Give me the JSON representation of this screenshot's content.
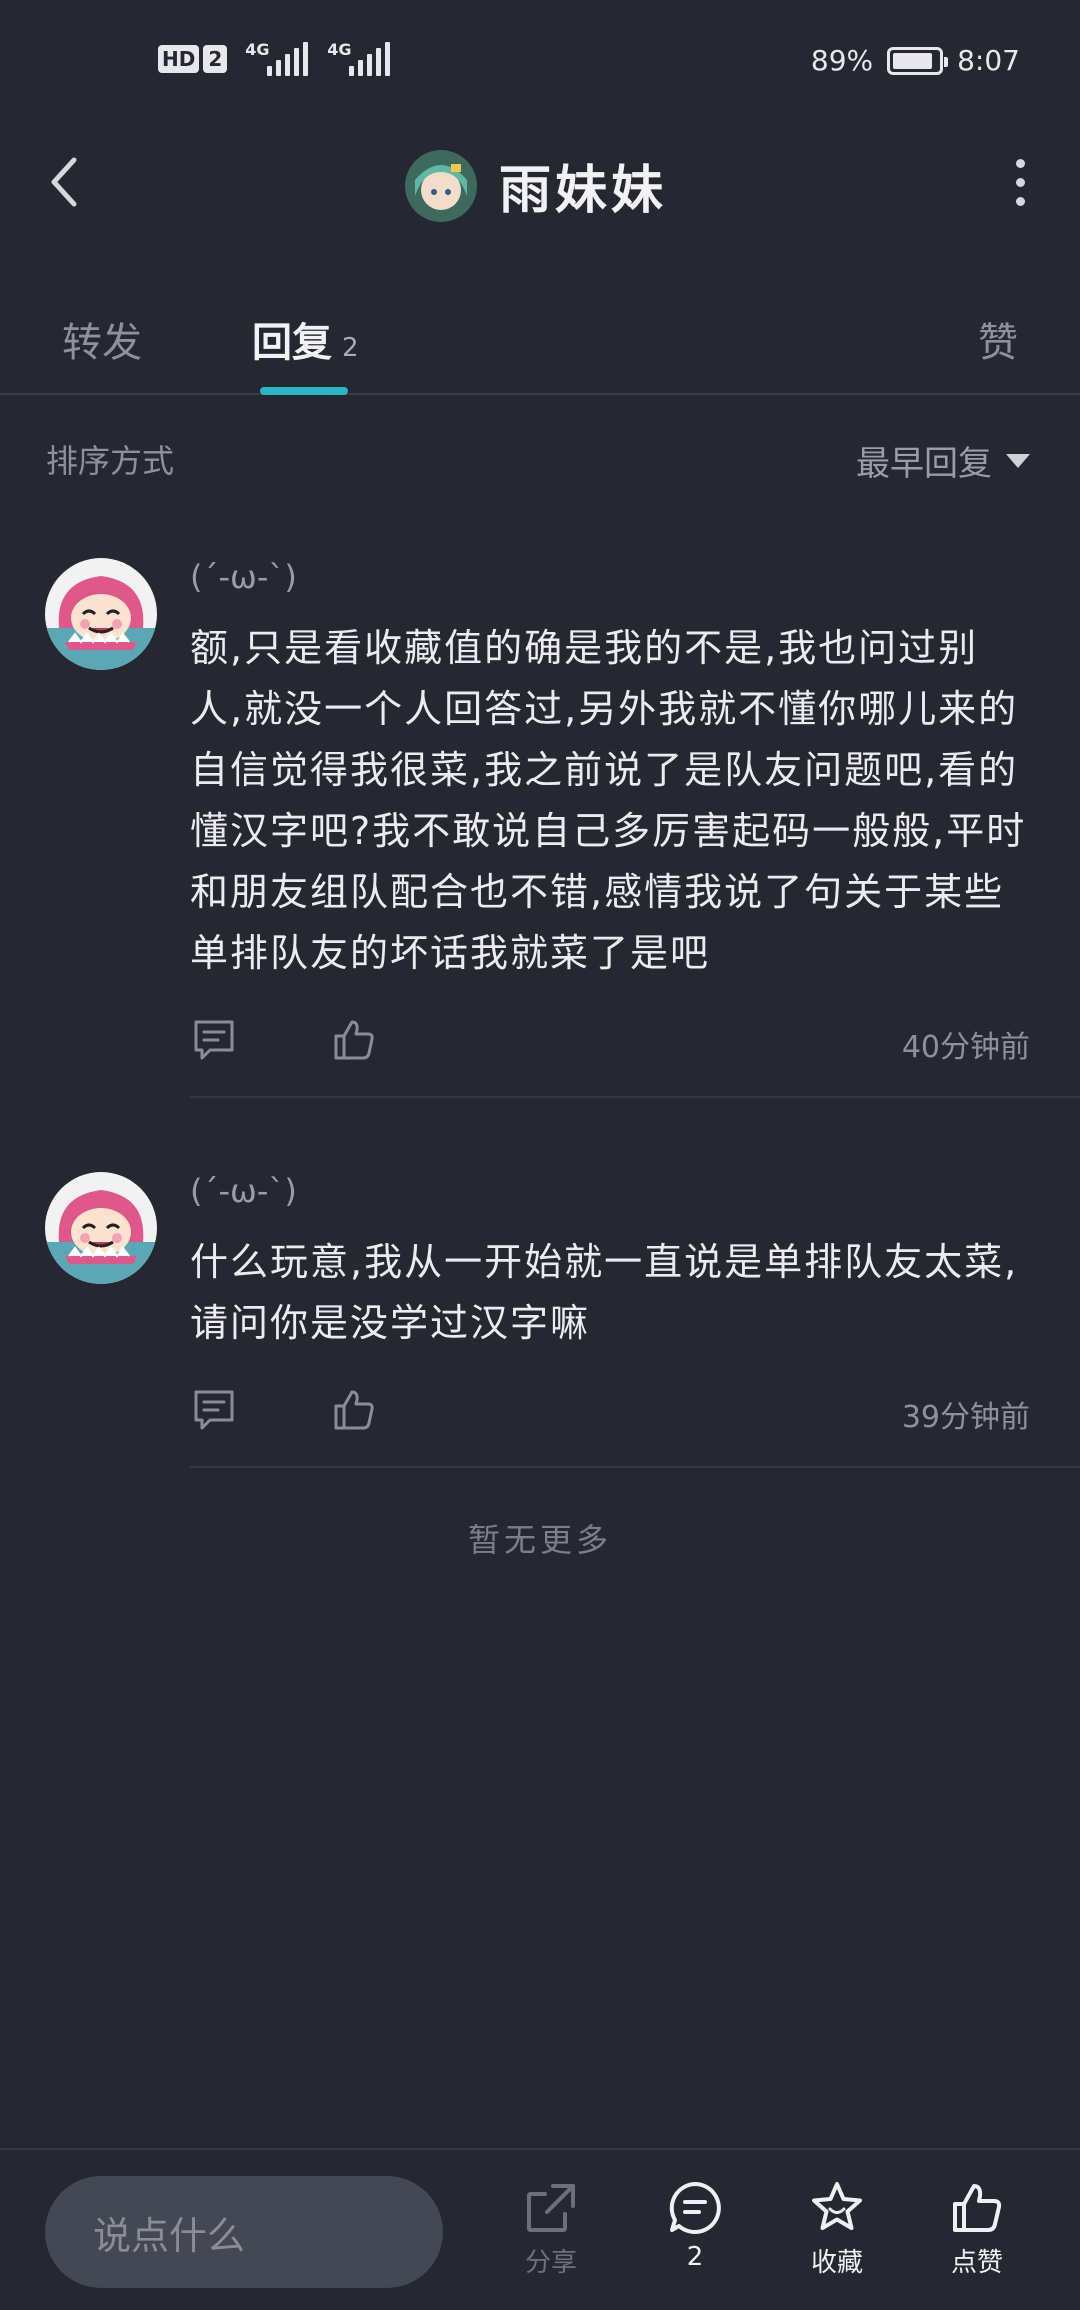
{
  "status_bar": {
    "hd_label": "HD",
    "hd_sim": "2",
    "network_1": "4G",
    "network_2": "4G",
    "battery_percent": "89%",
    "battery_level": 0.89,
    "time": "8:07"
  },
  "header": {
    "title": "雨妹妹",
    "back_icon": "chevron-left-icon",
    "more_icon": "more-vertical-icon"
  },
  "tabs": {
    "forward": "转发",
    "reply": "回复",
    "reply_count": "2",
    "like": "赞",
    "active": "reply",
    "accent": "#27b7c6"
  },
  "sort": {
    "label": "排序方式",
    "selected": "最早回复"
  },
  "comments": [
    {
      "name": "(´-ω-`)",
      "text": "额,只是看收藏值的确是我的不是,我也问过别人,就没一个人回答过,另外我就不懂你哪儿来的自信觉得我很菜,我之前说了是队友问题吧,看的懂汉字吧?我不敢说自己多厉害起码一般般,平时和朋友组队配合也不错,感情我说了句关于某些单排队友的坏话我就菜了是吧",
      "time": "40分钟前"
    },
    {
      "name": "(´-ω-`)",
      "text": "什么玩意,我从一开始就一直说是单排队友太菜,请问你是没学过汉字嘛",
      "time": "39分钟前"
    }
  ],
  "no_more": "暂无更多",
  "bottom_bar": {
    "input_placeholder": "说点什么",
    "share_label": "分享",
    "comments_count": "2",
    "favorite_label": "收藏",
    "like_label": "点赞"
  }
}
